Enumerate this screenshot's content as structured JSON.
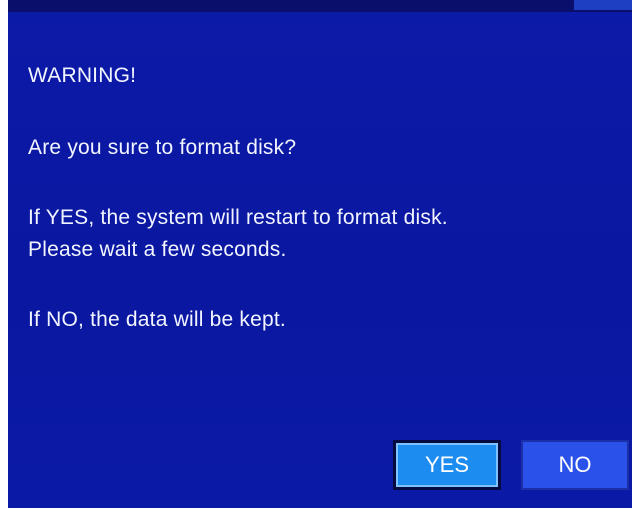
{
  "dialog": {
    "warning_title": "WARNING!",
    "question": "Are you sure to format disk?",
    "yes_info_line1": "If YES, the system will restart to format disk.",
    "yes_info_line2": "Please wait a few seconds.",
    "no_info": "If NO, the data will be kept.",
    "yes_label": "YES",
    "no_label": "NO",
    "colors": {
      "background": "#0b19a4",
      "text": "#f2f5ff",
      "yes_button": "#1d8cf0",
      "no_button": "#2a52ea"
    }
  }
}
